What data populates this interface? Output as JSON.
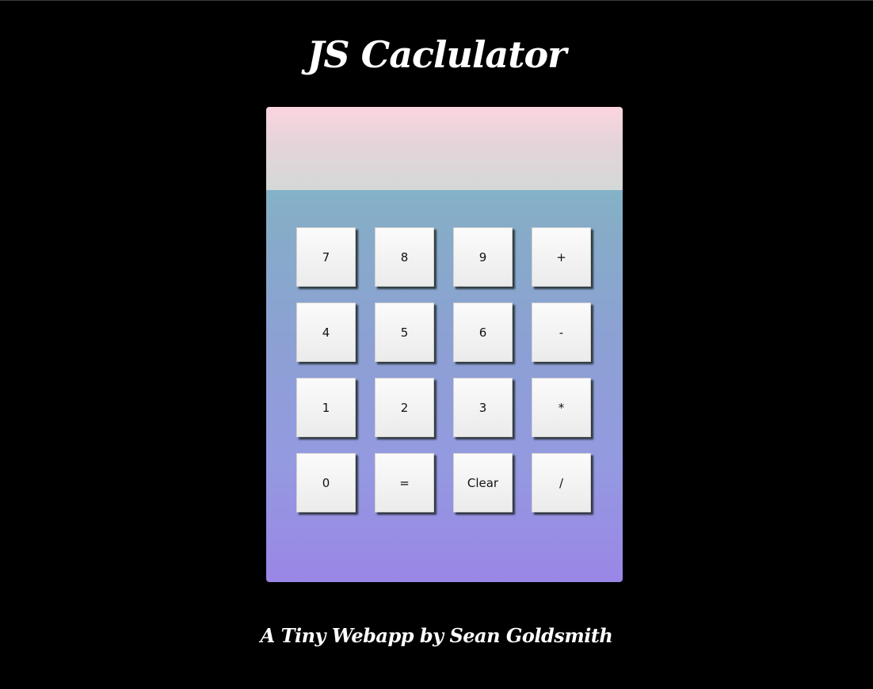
{
  "header": {
    "title": "JS Caclulator"
  },
  "display": {
    "value": ""
  },
  "keypad": {
    "keys": [
      "7",
      "8",
      "9",
      "+",
      "4",
      "5",
      "6",
      "-",
      "1",
      "2",
      "3",
      "*",
      "0",
      "=",
      "Clear",
      "/"
    ]
  },
  "footer": {
    "credit": "A Tiny Webapp by Sean Goldsmith"
  },
  "colors": {
    "background": "#000000",
    "display_top": "#fbd5df",
    "display_bottom": "#d5d8d8",
    "body_top": "#80c0c4",
    "body_bottom": "#9a86e6",
    "key_face": "#f2f2f2"
  }
}
